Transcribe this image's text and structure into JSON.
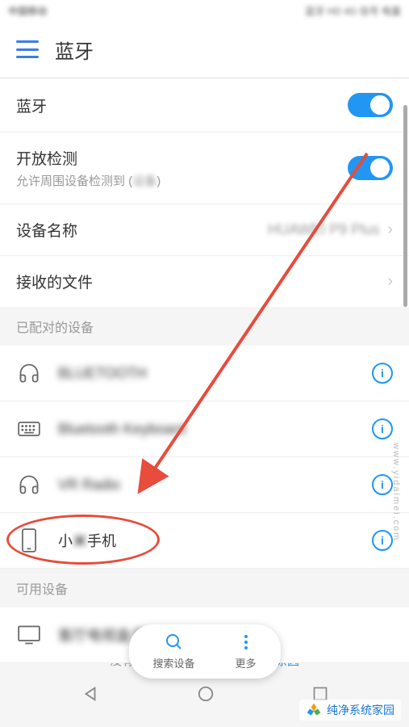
{
  "status_bar": {
    "left": "中国移动",
    "right": "蓝牙 HD 4G 信号 电量"
  },
  "header": {
    "title": "蓝牙"
  },
  "settings": {
    "bluetooth": {
      "label": "蓝牙",
      "enabled": true
    },
    "discovery": {
      "label": "开放检测",
      "subtitle_prefix": "允许周围设备检测到 (",
      "subtitle_blur": "设备",
      "subtitle_suffix": ")",
      "enabled": true
    },
    "device_name": {
      "label": "设备名称",
      "value": "HUAWEI P9 Plus"
    },
    "received_files": {
      "label": "接收的文件"
    }
  },
  "paired_section": {
    "header": "已配对的设备",
    "devices": [
      {
        "name": "BLUETOOTH",
        "icon": "headphones",
        "blurred": true
      },
      {
        "name": "Bluetooth Keyboard",
        "icon": "keyboard",
        "blurred": true
      },
      {
        "name": "VR Radio",
        "icon": "headphones",
        "blurred": true
      },
      {
        "name_prefix": "小",
        "name_blur": "米",
        "name_suffix": "手机",
        "icon": "phone",
        "highlighted": true
      }
    ]
  },
  "available_section": {
    "header": "可用设备",
    "devices": [
      {
        "name": "客厅电视盒子",
        "icon": "monitor",
        "blurred": true
      }
    ]
  },
  "bottom_actions": {
    "search": "搜索设备",
    "more": "更多"
  },
  "hint_prefix": "没有",
  "hint_suffix": "原因",
  "watermark": "www.yidaimei.com",
  "logo_text": "纯净系统家园",
  "colors": {
    "accent": "#2196f3",
    "highlight": "#e74c3c"
  }
}
